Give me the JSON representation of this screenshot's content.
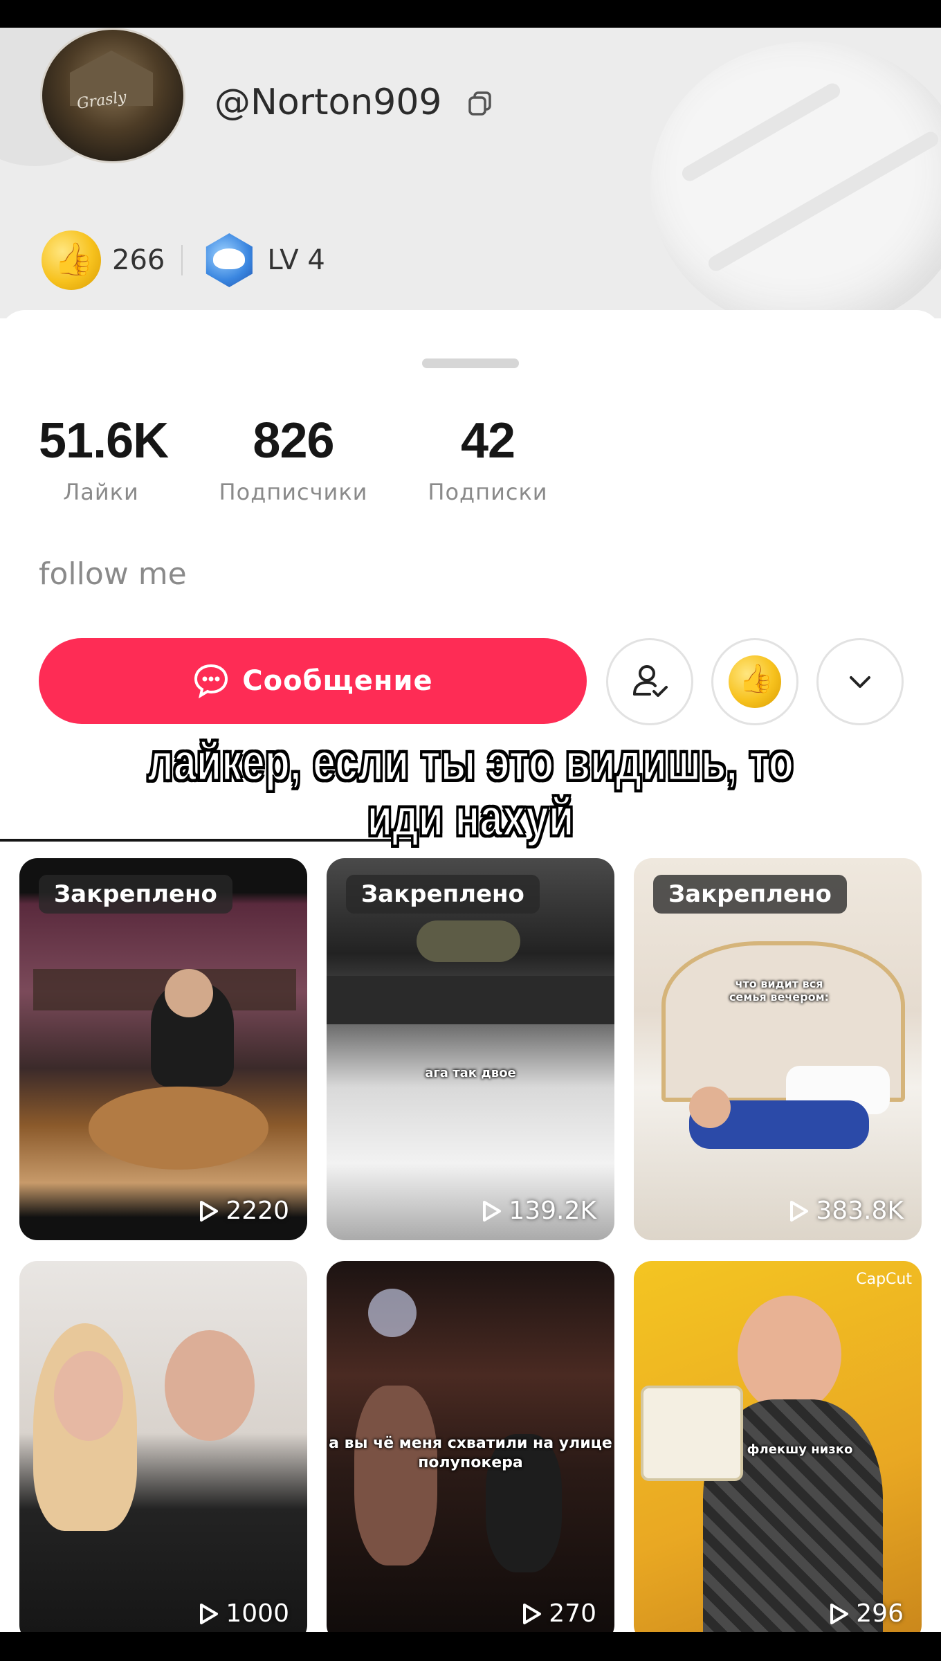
{
  "profile": {
    "username": "@Norton909",
    "coins": "266",
    "level": "LV 4",
    "bio": "follow me"
  },
  "stats": [
    {
      "value": "51.6K",
      "label": "Лайки"
    },
    {
      "value": "826",
      "label": "Подписчики"
    },
    {
      "value": "42",
      "label": "Подписки"
    }
  ],
  "actions": {
    "message_label": "Сообщение"
  },
  "overlay_caption": "лайкер, если ты это видишь, то иди нахуй",
  "videos": [
    {
      "pinned": "Закреплено",
      "views": "2220"
    },
    {
      "pinned": "Закреплено",
      "views": "139.2K",
      "subtitle": "ага так двое"
    },
    {
      "pinned": "Закреплено",
      "views": "383.8K",
      "subtitle": "что видит вся семья вечером:"
    },
    {
      "views": "1000"
    },
    {
      "views": "270",
      "subtitle": "а вы чё меня схватили на улице полупокера"
    },
    {
      "views": "296",
      "subtitle": "флекшу низко",
      "watermark": "CapCut"
    }
  ],
  "colors": {
    "accent": "#fe2c55",
    "coin": "#f7c21e",
    "level": "#3a86e0"
  },
  "icons": [
    "copy-icon",
    "coin-icon",
    "level-badge-icon",
    "message-bubble-icon",
    "friends-icon",
    "chevron-down-icon",
    "play-icon"
  ]
}
